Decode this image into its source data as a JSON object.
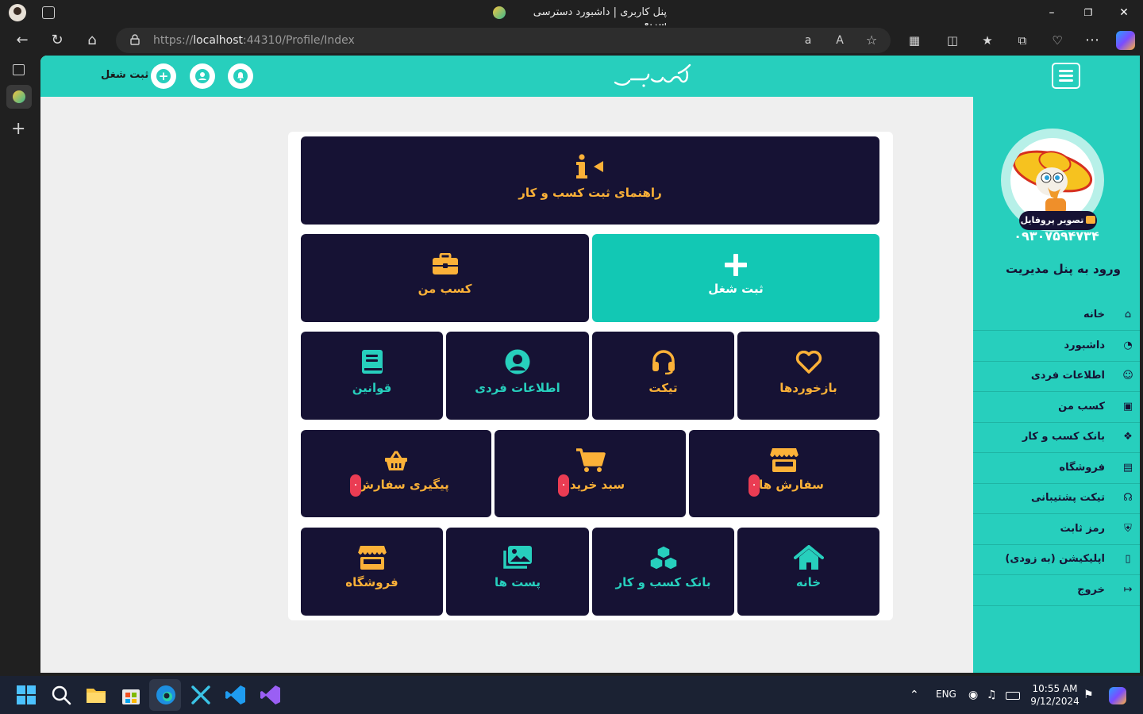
{
  "browser": {
    "tab_title": "پنل کاربری | داشبورد دسترسی سریع",
    "url_prefix": "https://",
    "url_host": "localhost",
    "url_rest": ":44310/Profile/Index"
  },
  "header": {
    "add_job_label": "ثبت شغل",
    "logo_text": "کسبوون"
  },
  "sidebar": {
    "profile_badge": "تصویر پروفایل",
    "phone": "۰۹۳۰۷۵۹۴۷۳۴",
    "admin_link": "ورود به پنل مدیریت",
    "items": [
      {
        "label": "خانه",
        "icon": "home-icon"
      },
      {
        "label": "داشبورد",
        "icon": "gauge-icon"
      },
      {
        "label": "اطلاعات فردی",
        "icon": "user-icon"
      },
      {
        "label": "کسب من",
        "icon": "briefcase-icon"
      },
      {
        "label": "بانک کسب و کار",
        "icon": "cubes-icon"
      },
      {
        "label": "فروشگاه",
        "icon": "store-icon"
      },
      {
        "label": "تیکت پشتیبانی",
        "icon": "headset-icon"
      },
      {
        "label": "رمز ثابت",
        "icon": "shield-icon"
      },
      {
        "label": "اپلیکیشن (به زودی)",
        "icon": "mobile-icon"
      },
      {
        "label": "خروج",
        "icon": "logout-icon"
      }
    ]
  },
  "tiles": {
    "guide": "راهنمای ثبت کسب و کار",
    "my_business": "کسب من",
    "add_job": "ثبت شغل",
    "rules": "قوانین",
    "personal_info": "اطلاعات فردی",
    "ticket": "تیکت",
    "feedback": "بازخوردها",
    "order_tracking": "پیگیری سفارش",
    "cart": "سبد خرید",
    "orders": "سفارش ها",
    "shop": "فروشگاه",
    "posts": "پست ها",
    "business_bank": "بانک کسب و کار",
    "home": "خانه",
    "badge_tracking": "۰",
    "badge_cart": "۰",
    "badge_orders": "۰"
  },
  "taskbar": {
    "lang": "ENG",
    "time": "10:55 AM",
    "date": "9/12/2024"
  },
  "colors": {
    "accent_teal": "#27cfbd",
    "tile_dark": "#161234",
    "tile_orange_text": "#fbb138",
    "badge_red": "#ea3c53"
  }
}
